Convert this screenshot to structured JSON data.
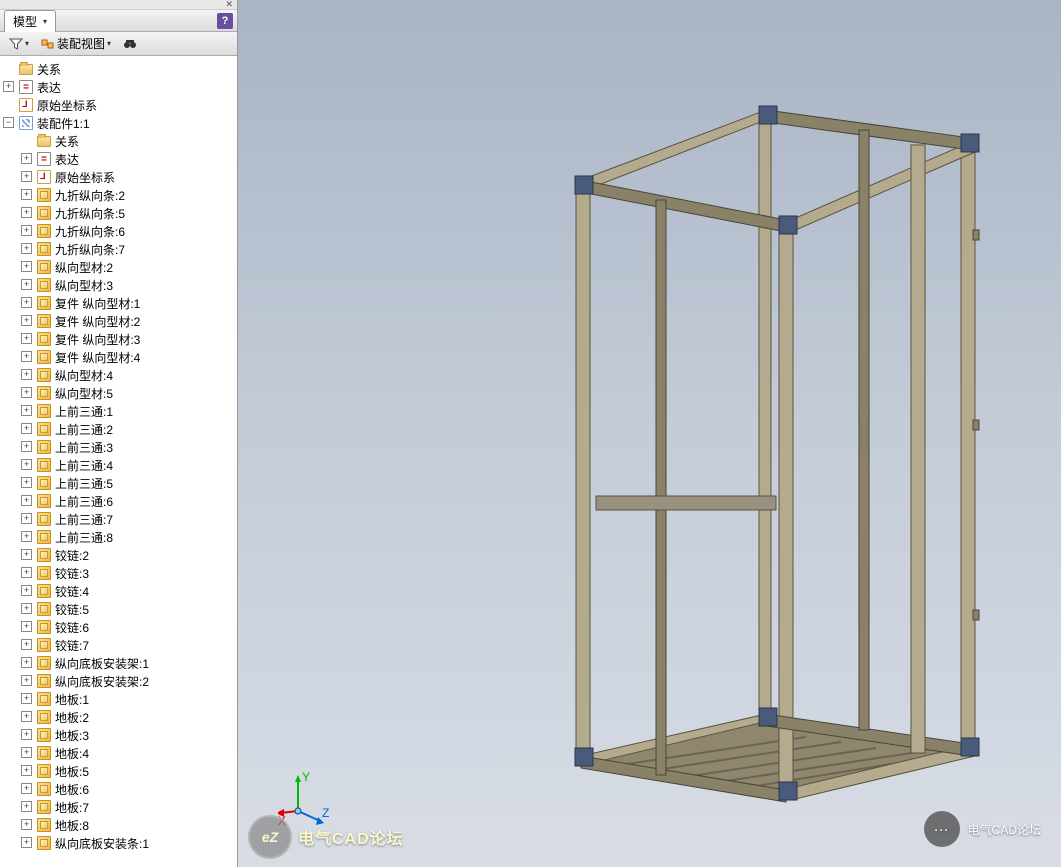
{
  "panel": {
    "tab_label": "模型",
    "toolbar": {
      "view_label": "装配视图"
    }
  },
  "axes": {
    "x": "X",
    "y": "Y",
    "z": "Z"
  },
  "watermark": {
    "bottom_left": "电气CAD论坛",
    "bottom_left_badge": "eZ",
    "chat_label": "电气CAD论坛"
  },
  "tree": [
    {
      "d": 0,
      "exp": "",
      "icon": "folder",
      "label": "关系"
    },
    {
      "d": 0,
      "exp": "+",
      "icon": "expr",
      "label": "表达"
    },
    {
      "d": 0,
      "exp": "",
      "icon": "csys",
      "label": "原始坐标系"
    },
    {
      "d": 0,
      "exp": "-",
      "icon": "asm",
      "label": "装配件1:1"
    },
    {
      "d": 1,
      "exp": "",
      "icon": "folder",
      "label": "关系"
    },
    {
      "d": 1,
      "exp": "+",
      "icon": "expr",
      "label": "表达"
    },
    {
      "d": 1,
      "exp": "+",
      "icon": "csys",
      "label": "原始坐标系"
    },
    {
      "d": 1,
      "exp": "+",
      "icon": "part",
      "label": "九折纵向条:2"
    },
    {
      "d": 1,
      "exp": "+",
      "icon": "part",
      "label": "九折纵向条:5"
    },
    {
      "d": 1,
      "exp": "+",
      "icon": "part",
      "label": "九折纵向条:6"
    },
    {
      "d": 1,
      "exp": "+",
      "icon": "part",
      "label": "九折纵向条:7"
    },
    {
      "d": 1,
      "exp": "+",
      "icon": "part",
      "label": "纵向型材:2"
    },
    {
      "d": 1,
      "exp": "+",
      "icon": "part",
      "label": "纵向型材:3"
    },
    {
      "d": 1,
      "exp": "+",
      "icon": "part",
      "label": "复件 纵向型材:1"
    },
    {
      "d": 1,
      "exp": "+",
      "icon": "part",
      "label": "复件 纵向型材:2"
    },
    {
      "d": 1,
      "exp": "+",
      "icon": "part",
      "label": "复件 纵向型材:3"
    },
    {
      "d": 1,
      "exp": "+",
      "icon": "part",
      "label": "复件 纵向型材:4"
    },
    {
      "d": 1,
      "exp": "+",
      "icon": "part",
      "label": "纵向型材:4"
    },
    {
      "d": 1,
      "exp": "+",
      "icon": "part",
      "label": "纵向型材:5"
    },
    {
      "d": 1,
      "exp": "+",
      "icon": "part",
      "label": "上前三通:1"
    },
    {
      "d": 1,
      "exp": "+",
      "icon": "part",
      "label": "上前三通:2"
    },
    {
      "d": 1,
      "exp": "+",
      "icon": "part",
      "label": "上前三通:3"
    },
    {
      "d": 1,
      "exp": "+",
      "icon": "part",
      "label": "上前三通:4"
    },
    {
      "d": 1,
      "exp": "+",
      "icon": "part",
      "label": "上前三通:5"
    },
    {
      "d": 1,
      "exp": "+",
      "icon": "part",
      "label": "上前三通:6"
    },
    {
      "d": 1,
      "exp": "+",
      "icon": "part",
      "label": "上前三通:7"
    },
    {
      "d": 1,
      "exp": "+",
      "icon": "part",
      "label": "上前三通:8"
    },
    {
      "d": 1,
      "exp": "+",
      "icon": "part",
      "label": "铰链:2"
    },
    {
      "d": 1,
      "exp": "+",
      "icon": "part",
      "label": "铰链:3"
    },
    {
      "d": 1,
      "exp": "+",
      "icon": "part",
      "label": "铰链:4"
    },
    {
      "d": 1,
      "exp": "+",
      "icon": "part",
      "label": "铰链:5"
    },
    {
      "d": 1,
      "exp": "+",
      "icon": "part",
      "label": "铰链:6"
    },
    {
      "d": 1,
      "exp": "+",
      "icon": "part",
      "label": "铰链:7"
    },
    {
      "d": 1,
      "exp": "+",
      "icon": "part",
      "label": "纵向底板安装架:1"
    },
    {
      "d": 1,
      "exp": "+",
      "icon": "part",
      "label": "纵向底板安装架:2"
    },
    {
      "d": 1,
      "exp": "+",
      "icon": "part",
      "label": "地板:1"
    },
    {
      "d": 1,
      "exp": "+",
      "icon": "part",
      "label": "地板:2"
    },
    {
      "d": 1,
      "exp": "+",
      "icon": "part",
      "label": "地板:3"
    },
    {
      "d": 1,
      "exp": "+",
      "icon": "part",
      "label": "地板:4"
    },
    {
      "d": 1,
      "exp": "+",
      "icon": "part",
      "label": "地板:5"
    },
    {
      "d": 1,
      "exp": "+",
      "icon": "part",
      "label": "地板:6"
    },
    {
      "d": 1,
      "exp": "+",
      "icon": "part",
      "label": "地板:7"
    },
    {
      "d": 1,
      "exp": "+",
      "icon": "part",
      "label": "地板:8"
    },
    {
      "d": 1,
      "exp": "+",
      "icon": "part",
      "label": "纵向底板安装条:1"
    }
  ]
}
